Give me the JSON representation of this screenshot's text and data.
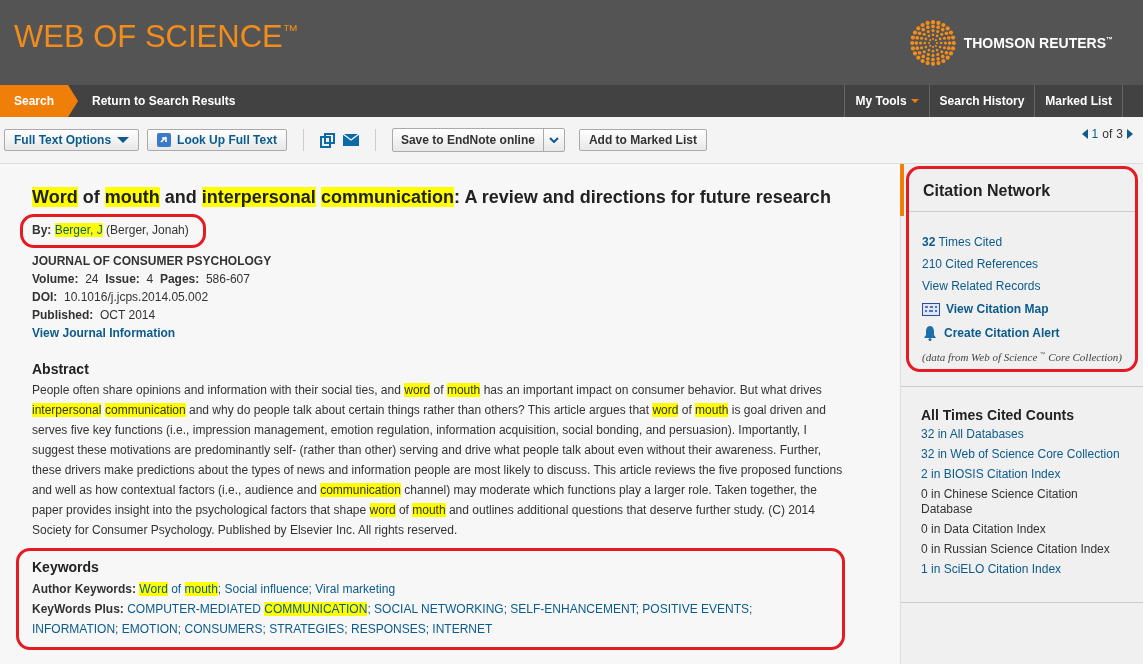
{
  "header": {
    "logo": "WEB OF SCIENCE$^{™}$",
    "brand": "THOMSON REUTERS$^{™}$"
  },
  "nav": {
    "left": [
      {
        "label": "Search",
        "selected": true
      },
      {
        "label": "Return to Search Results",
        "selected": false
      }
    ],
    "right": [
      {
        "label": "My Tools",
        "dropdown": true
      },
      {
        "label": "Search History",
        "dropdown": false
      },
      {
        "label": "Marked List",
        "dropdown": false
      }
    ]
  },
  "toolbar": {
    "full_text_options": "Full Text Options",
    "look_up": "Look Up Full Text",
    "save": "Save to EndNote online",
    "add_marked": "Add to Marked List",
    "pager": {
      "current": "1",
      "of": "of",
      "total": "3"
    }
  },
  "record": {
    "title": [
      {
        "text": "Word",
        "highlighted": true
      },
      {
        "text": " of ",
        "highlighted": false
      },
      {
        "text": "mouth",
        "highlighted": true
      },
      {
        "text": " and ",
        "highlighted": false
      },
      {
        "text": "interpersonal",
        "highlighted": true
      },
      {
        "text": "communication",
        "highlighted": true
      },
      {
        "text": ": A review and directions for future research",
        "highlighted": false
      }
    ],
    "by": {
      "label": "By:",
      "author": "Berger, J",
      "author_highlighted": true,
      "full_name": "(Berger, Jonah)",
      "circled": true
    },
    "journal": "JOURNAL OF CONSUMER PSYCHOLOGY",
    "meta": [
      {
        "label": "Volume:",
        "value": "24"
      },
      {
        "label": "Issue:",
        "value": "4"
      },
      {
        "label": "Pages:",
        "value": "586-607"
      }
    ],
    "doi": {
      "label": "DOI:",
      "value": "10.1016/j.jcps.2014.05.002"
    },
    "published": {
      "label": "Published:",
      "value": "OCT 2014"
    },
    "journal_link": "View Journal Information",
    "abstract": {
      "heading": "Abstract",
      "segments": [
        {
          "text": "People often share opinions and information with their social ties, and ",
          "highlighted": false
        },
        {
          "text": "word",
          "highlighted": true
        },
        {
          "text": " of ",
          "highlighted": false
        },
        {
          "text": "mouth",
          "highlighted": true
        },
        {
          "text": " has an important impact on consumer behavior. But what drives ",
          "highlighted": false
        },
        {
          "text": "interpersonal",
          "highlighted": true
        },
        {
          "text": "communication",
          "highlighted": true
        },
        {
          "text": " and why do people talk about certain things rather than others? This article argues that ",
          "highlighted": false
        },
        {
          "text": "word",
          "highlighted": true
        },
        {
          "text": " of ",
          "highlighted": false
        },
        {
          "text": "mouth",
          "highlighted": true
        },
        {
          "text": " is goal driven and serves five key functions (i.e., impression management, emotion regulation, information acquisition, social bonding, and persuasion). Importantly, I suggest these motivations are predominantly self- (rather than other) serving and drive what people talk about even without their awareness. Further, these drivers make predictions about the types of news and information people are most likely to discuss. This article reviews the five proposed functions and well as how contextual factors (i.e., audience and ",
          "highlighted": false
        },
        {
          "text": "communication",
          "highlighted": true
        },
        {
          "text": " channel) may moderate which functions play a larger role. Taken together, the paper provides insight into the psychological factors that shape ",
          "highlighted": false
        },
        {
          "text": "word",
          "highlighted": true
        },
        {
          "text": " of ",
          "highlighted": false
        },
        {
          "text": "mouth",
          "highlighted": true
        },
        {
          "text": " and outlines additional questions that deserve further study. (C) 2014 Society for Consumer Psychology. Published by Elsevier Inc. All rights reserved.",
          "highlighted": false
        }
      ]
    },
    "keywords": {
      "heading": "Keywords",
      "circled": true,
      "groups": [
        {
          "label": "Author Keywords:",
          "items": [
            [
              {
                "text": "Word",
                "highlighted": true
              },
              {
                "text": " of ",
                "highlighted": false
              },
              {
                "text": "mouth",
                "highlighted": true
              },
              {
                "text": ";",
                "highlighted": false
              }
            ],
            [
              {
                "text": "Social influence;",
                "highlighted": false
              }
            ],
            [
              {
                "text": "Viral marketing",
                "highlighted": false
              }
            ]
          ]
        },
        {
          "label": "KeyWords Plus:",
          "items": [
            [
              {
                "text": "COMPUTER-MEDIATED ",
                "highlighted": false
              },
              {
                "text": "COMMUNICATION",
                "highlighted": true
              },
              {
                "text": ";",
                "highlighted": false
              }
            ],
            [
              {
                "text": "SOCIAL NETWORKING;",
                "highlighted": false
              }
            ],
            [
              {
                "text": "SELF-ENHANCEMENT;",
                "highlighted": false
              }
            ],
            [
              {
                "text": "POSITIVE EVENTS;",
                "highlighted": false
              }
            ],
            [
              {
                "text": "INFORMATION;",
                "highlighted": false
              }
            ],
            [
              {
                "text": "EMOTION;",
                "highlighted": false
              }
            ],
            [
              {
                "text": "CONSUMERS;",
                "highlighted": false
              }
            ],
            [
              {
                "text": "STRATEGIES;",
                "highlighted": false
              }
            ],
            [
              {
                "text": "RESPONSES;",
                "highlighted": false
              }
            ],
            [
              {
                "text": "INTERNET",
                "highlighted": false
              }
            ]
          ]
        }
      ]
    }
  },
  "citation_network": {
    "title": "Citation Network",
    "circled": true,
    "times_cited": {
      "count": "32",
      "label": "Times Cited"
    },
    "links": [
      "210 Cited References",
      "View Related Records"
    ],
    "actions": [
      {
        "kind": "map",
        "label": "View Citation Map"
      },
      {
        "kind": "alert",
        "label": "Create Citation Alert"
      }
    ],
    "note": "(data from Web of Science $^{™}$ Core Collection)"
  },
  "all_times_cited": {
    "title": "All Times Cited Counts",
    "items": [
      {
        "text": "32 in All Databases",
        "link": true
      },
      {
        "text": "32 in Web of Science Core Collection",
        "link": true
      },
      {
        "text": "2 in BIOSIS Citation Index",
        "link": true
      },
      {
        "text": "0 in Chinese Science Citation Database",
        "link": false
      },
      {
        "text": "0 in Data Citation Index",
        "link": false
      },
      {
        "text": "0 in Russian Science Citation Index",
        "link": false
      },
      {
        "text": "1 in SciELO Citation Index",
        "link": true
      }
    ]
  }
}
